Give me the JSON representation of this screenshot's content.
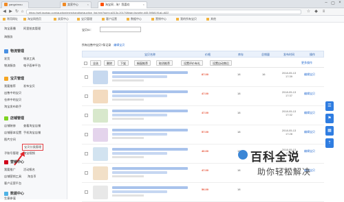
{
  "browser": {
    "tabs": [
      {
        "label": "yangxinrou",
        "icon_color": "#f08a24"
      },
      {
        "label": "卖家中心",
        "icon_color": "#f08a24"
      },
      {
        "label": "淘宝网 - 淘！我喜欢",
        "icon_color": "#ff5000"
      }
    ],
    "url": "https://sell.taobao.com/auction/merchandise/auction_list.htm?spm=a313o.201708ban.favorite.d45.5958191aLu622",
    "bookmarks": [
      "常用网址",
      "淘宝网首页",
      "卖家中心",
      "宝贝管理",
      "客户运营",
      "数据中心",
      "营销中心",
      "我的所有宝贝",
      "其他"
    ]
  },
  "sidebar": {
    "sections": [
      {
        "title": "物流管理",
        "icon_color": "#4a90e2",
        "links": [
          "发货",
          "物流工具",
          "物流服务",
          "电子面单平台"
        ]
      },
      {
        "title": "宝贝管理",
        "icon_color": "#f5a623",
        "links": [
          "我要推荐",
          "发布宝贝",
          "出售中的宝贝",
          "仓库中的宝贝",
          "淘宝发布助手"
        ]
      },
      {
        "title": "店铺管理",
        "icon_color": "#7ed321",
        "links": [
          "店铺装修",
          "查看淘宝店铺",
          "店铺基本设置",
          "手机淘宝店铺",
          "图片空间",
          "宝贝分类管理",
          "淘宝视频",
          "子账号管理"
        ]
      },
      {
        "title": "营销中心",
        "icon_color": "#d0021b",
        "links": [
          "我要推广",
          "活动报名",
          "店铺营销工具",
          "淘金币",
          "客户运营平台"
        ]
      },
      {
        "title": "数据中心",
        "icon_color": "#50b3e5",
        "links": [
          "生意参谋"
        ]
      }
    ],
    "top_links": [
      "淘宝直播",
      "阿里拍卖管理",
      "海服务"
    ],
    "highlighted": "宝贝分类管理"
  },
  "content": {
    "field_label": "宝贝ID：",
    "banner": "所有出售中宝贝7条记录",
    "banner_link": "编辑宝贝",
    "columns": [
      "宝贝名称",
      "价格",
      "库存",
      "总销量",
      "发布时间",
      "操作"
    ],
    "toolbar": [
      "全选",
      "删除",
      "下架",
      "橱窗推荐",
      "取消推荐",
      "设置评价有礼",
      "设置自动售后",
      "更多操作"
    ],
    "rows": [
      {
        "price": "87.00",
        "stock": "18",
        "sales": "16",
        "date": "2018-05-13\n17:39",
        "action": "编辑宝贝",
        "thumb": "#c7d9ef"
      },
      {
        "price": "47.00",
        "stock": "18",
        "sales": "",
        "date": "2018-05-13\n17:37",
        "action": "编辑宝贝",
        "thumb": "#f3dbc0"
      },
      {
        "price": "47.00",
        "stock": "18",
        "sales": "",
        "date": "2018-05-13\n17:32",
        "action": "编辑宝贝",
        "thumb": "#d8e8cc"
      },
      {
        "price": "57.00",
        "stock": "18",
        "sales": "",
        "date": "2018-05-13\n17:28",
        "action": "编辑宝贝",
        "thumb": "#e4d4ec"
      },
      {
        "price": "40.00",
        "stock": "18",
        "sales": "",
        "date": "2018-05-13\n17:26",
        "action": "编辑宝贝",
        "thumb": "#d2e3f0"
      },
      {
        "price": "47.00",
        "stock": "18",
        "sales": "",
        "date": "2018-05-13\n17:24",
        "action": "编辑宝贝",
        "thumb": "#f2e0c8"
      },
      {
        "price": "56.00",
        "stock": "18",
        "sales": "",
        "date": "",
        "action": "",
        "thumb": "#e8e8e8"
      }
    ]
  },
  "watermark": {
    "main": "百科全说",
    "sub": "助你轻松解决"
  }
}
